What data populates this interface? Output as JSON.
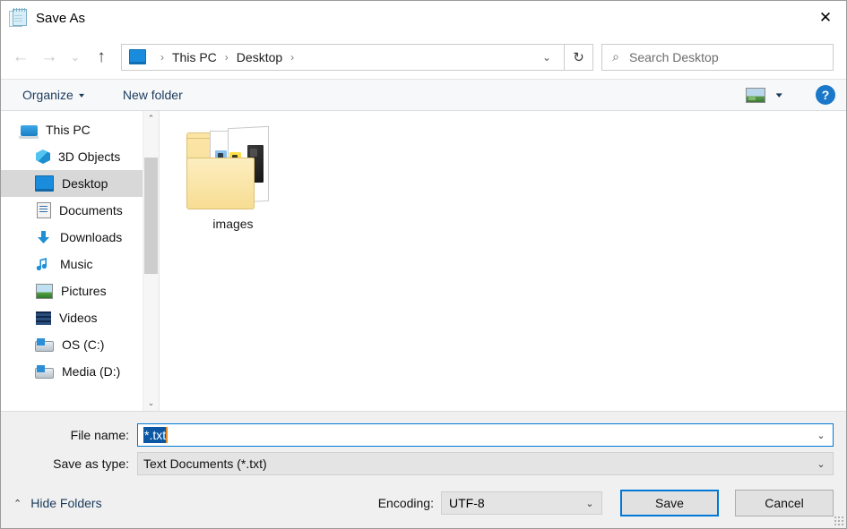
{
  "window": {
    "title": "Save As",
    "app_icon": "notepad-icon",
    "close_label": "✕"
  },
  "navbar": {
    "back_icon": "←",
    "forward_icon": "→",
    "recent_icon": "⌄",
    "up_icon": "↑",
    "breadcrumb": {
      "location_icon": "this-pc-icon",
      "items": [
        "This PC",
        "Desktop"
      ],
      "separator": "›",
      "dropdown_icon": "⌄"
    },
    "refresh_icon": "↻",
    "search": {
      "icon": "⌕",
      "placeholder": "Search Desktop",
      "value": ""
    }
  },
  "toolbar": {
    "organize_label": "Organize",
    "organize_caret": "▾",
    "new_folder_label": "New folder",
    "view_caret": "▾",
    "help_label": "?"
  },
  "sidebar": {
    "items": [
      {
        "label": "This PC",
        "icon": "computer-icon",
        "level": "root",
        "selected": false
      },
      {
        "label": "3D Objects",
        "icon": "3d-objects-icon",
        "level": "child",
        "selected": false
      },
      {
        "label": "Desktop",
        "icon": "desktop-icon",
        "level": "child",
        "selected": true
      },
      {
        "label": "Documents",
        "icon": "documents-icon",
        "level": "child",
        "selected": false
      },
      {
        "label": "Downloads",
        "icon": "downloads-icon",
        "level": "child",
        "selected": false
      },
      {
        "label": "Music",
        "icon": "music-icon",
        "level": "child",
        "selected": false
      },
      {
        "label": "Pictures",
        "icon": "pictures-icon",
        "level": "child",
        "selected": false
      },
      {
        "label": "Videos",
        "icon": "videos-icon",
        "level": "child",
        "selected": false
      },
      {
        "label": "OS (C:)",
        "icon": "drive-icon",
        "level": "child",
        "selected": false
      },
      {
        "label": "Media (D:)",
        "icon": "drive-icon",
        "level": "child",
        "selected": false
      }
    ],
    "scroll_up_icon": "⌃",
    "scroll_down_icon": "⌄"
  },
  "content": {
    "files": [
      {
        "name": "images",
        "type": "folder"
      }
    ]
  },
  "form": {
    "file_name_label": "File name:",
    "file_name_value": "*.txt",
    "file_name_caret": "⌄",
    "save_as_type_label": "Save as type:",
    "save_as_type_value": "Text Documents (*.txt)",
    "save_as_type_caret": "⌄"
  },
  "footer": {
    "hide_folders_label": "Hide Folders",
    "hide_folders_caret": "⌃",
    "encoding_label": "Encoding:",
    "encoding_value": "UTF-8",
    "encoding_caret": "⌄",
    "save_label": "Save",
    "cancel_label": "Cancel"
  },
  "colors": {
    "accent": "#0078d7",
    "selection": "#0b57a4",
    "caret": "#e88a24",
    "panel": "#f0f0f0",
    "tree_selected": "#d8d8d8"
  }
}
